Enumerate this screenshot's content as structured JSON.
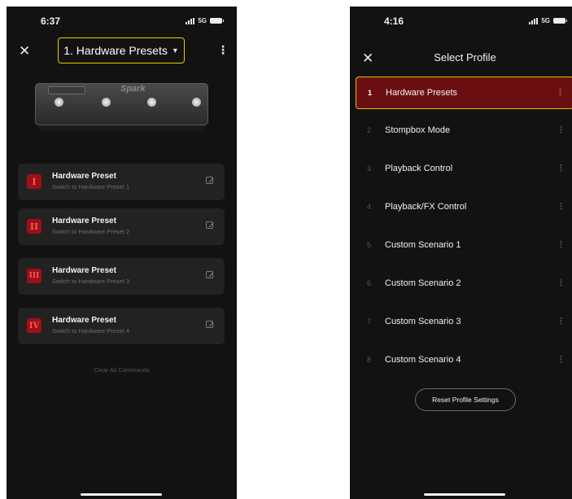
{
  "left_screen": {
    "status": {
      "time": "6:37",
      "network": "5G"
    },
    "header": {
      "close_icon": "close-icon",
      "preset_selector": "1. Hardware Presets",
      "more_icon": "kebab-menu-icon"
    },
    "device": {
      "logo": "Spark"
    },
    "commands": [
      {
        "numeral": "I",
        "title": "Hardware Preset",
        "subtitle": "Switch to Hardware Preset 1",
        "icon": "edit-icon"
      },
      {
        "numeral": "II",
        "title": "Hardware Preset",
        "subtitle": "Switch to Hardware Preset 2",
        "icon": "edit-icon"
      },
      {
        "numeral": "III",
        "title": "Hardware Preset",
        "subtitle": "Switch to Hardware Preset 3",
        "icon": "edit-icon"
      },
      {
        "numeral": "IV",
        "title": "Hardware Preset",
        "subtitle": "Switch to Hardware Preset 4",
        "icon": "edit-icon"
      }
    ],
    "clear_all": "Clear All Commands"
  },
  "right_screen": {
    "status": {
      "time": "4:16",
      "network": "5G"
    },
    "header": {
      "close_icon": "close-icon",
      "title": "Select Profile"
    },
    "profiles": [
      {
        "index": "1",
        "name": "Hardware Presets",
        "selected": true
      },
      {
        "index": "2",
        "name": "Stompbox Mode",
        "selected": false
      },
      {
        "index": "3",
        "name": "Playback Control",
        "selected": false
      },
      {
        "index": "4",
        "name": "Playback/FX Control",
        "selected": false
      },
      {
        "index": "5",
        "name": "Custom Scenario 1",
        "selected": false
      },
      {
        "index": "6",
        "name": "Custom Scenario 2",
        "selected": false
      },
      {
        "index": "7",
        "name": "Custom Scenario 3",
        "selected": false
      },
      {
        "index": "8",
        "name": "Custom Scenario 4",
        "selected": false
      }
    ],
    "reset_button": "Reset Profile Settings"
  },
  "colors": {
    "background": "#121212",
    "accent_outline": "#e4c200",
    "selected_row": "#6b0e12",
    "numeral_badge": "#9c1018",
    "card": "#222222"
  }
}
